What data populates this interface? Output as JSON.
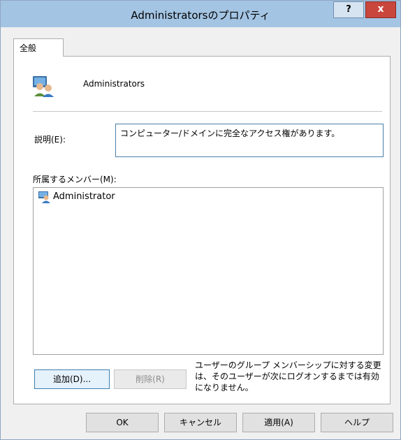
{
  "window": {
    "title": "Administratorsのプロパティ",
    "help_label": "?",
    "close_label": "x"
  },
  "tabs": [
    {
      "label": "全般"
    }
  ],
  "group": {
    "name": "Administrators",
    "icon": "group-users-icon"
  },
  "description": {
    "label": "説明(E):",
    "value": "コンピューター/ドメインに完全なアクセス権があります。"
  },
  "members": {
    "label": "所属するメンバー(M):",
    "items": [
      {
        "name": "Administrator",
        "icon": "user-icon"
      }
    ]
  },
  "actions": {
    "add_label": "追加(D)...",
    "remove_label": "削除(R)"
  },
  "note": "ユーザーのグループ メンバーシップに対する変更は、そのユーザーが次にログオンするまでは有効になりません。",
  "footer": {
    "ok_label": "OK",
    "cancel_label": "キャンセル",
    "apply_label": "適用(A)",
    "help_label": "ヘルプ"
  },
  "colors": {
    "titlebar": "#a3c4e3",
    "close_button": "#c9463c",
    "description_border": "#4a7fa8"
  }
}
